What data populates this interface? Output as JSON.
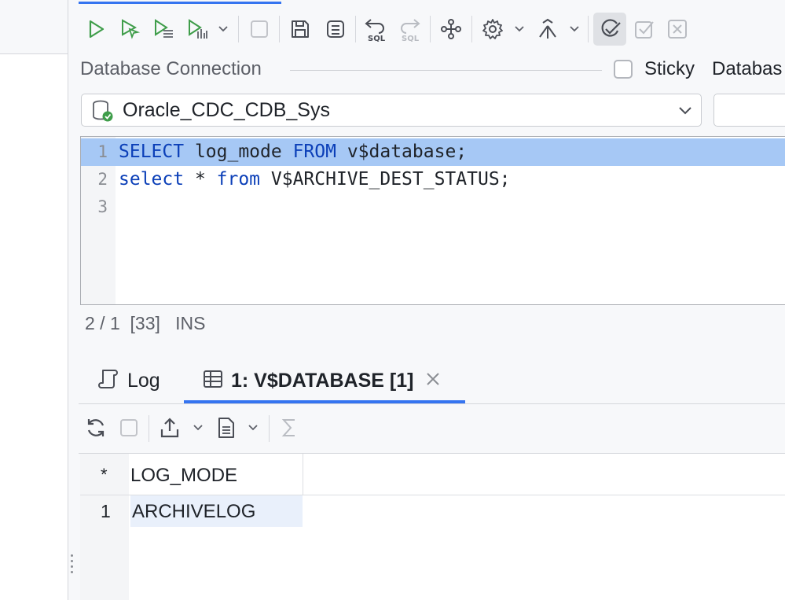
{
  "toolbar": {
    "buttons": [
      "run-icon",
      "run-cursor-icon",
      "run-script-icon",
      "explain-plan-icon",
      "stop-icon",
      "save-icon",
      "save-as-icon",
      "undo-sql-icon",
      "redo-sql-icon",
      "share-icon",
      "settings-icon",
      "merge-icon",
      "commit-icon",
      "checkbox-icon",
      "cancel-icon"
    ]
  },
  "connection": {
    "label": "Database Connection",
    "sticky_label": "Sticky",
    "database_label": "Databas",
    "selected": "Oracle_CDC_CDB_Sys"
  },
  "editor": {
    "lines": [
      {
        "num": "1",
        "segments": [
          [
            "kw",
            "SELECT"
          ],
          [
            "t",
            " log_mode "
          ],
          [
            "kw",
            "FROM"
          ],
          [
            "t",
            " v$database;"
          ]
        ]
      },
      {
        "num": "2",
        "segments": [
          [
            "kw",
            "select"
          ],
          [
            "t",
            " * "
          ],
          [
            "kw",
            "from"
          ],
          [
            "t",
            " V$ARCHIVE_DEST_STATUS;"
          ]
        ]
      },
      {
        "num": "3",
        "segments": []
      }
    ]
  },
  "status": {
    "position": "2 / 1",
    "offset": "[33]",
    "mode": "INS"
  },
  "tabs": {
    "log": "Log",
    "result": "1: V$DATABASE [1]"
  },
  "grid": {
    "corner": "*",
    "columns": [
      "LOG_MODE"
    ],
    "rows": [
      {
        "num": "1",
        "cells": [
          "ARCHIVELOG"
        ]
      }
    ]
  },
  "colors": {
    "accent": "#3574f0",
    "keyword": "#0b3fb8",
    "current_line": "#a6c8f5",
    "run_green": "#3f9d4a"
  }
}
